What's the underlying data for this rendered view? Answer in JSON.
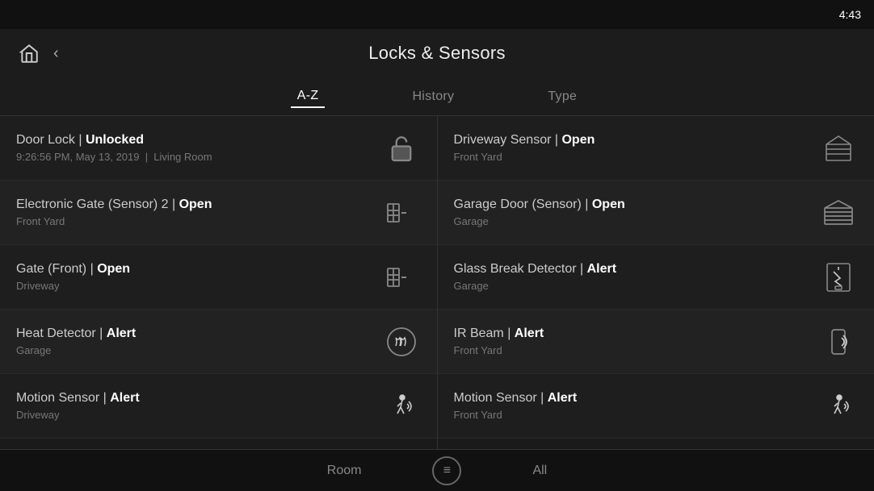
{
  "topbar": {
    "time": "4:43"
  },
  "header": {
    "title": "Locks & Sensors",
    "back_label": "‹",
    "home_icon": "🏠"
  },
  "tabs": [
    {
      "id": "az",
      "label": "A-Z",
      "active": true
    },
    {
      "id": "history",
      "label": "History",
      "active": false
    },
    {
      "id": "type",
      "label": "Type",
      "active": false
    }
  ],
  "left_col": [
    {
      "name": "Door Lock",
      "status": "Unlocked",
      "sub": "9:26:56 PM, May 13, 2019  |  Living Room",
      "icon": "lock"
    },
    {
      "name": "Electronic Gate (Sensor) 2",
      "status": "Open",
      "sub": "Front Yard",
      "icon": "gate"
    },
    {
      "name": "Gate (Front)",
      "status": "Open",
      "sub": "Driveway",
      "icon": "gate"
    },
    {
      "name": "Heat Detector",
      "status": "Alert",
      "sub": "Garage",
      "icon": "heat"
    },
    {
      "name": "Motion Sensor",
      "status": "Alert",
      "sub": "Driveway",
      "icon": "motion"
    }
  ],
  "right_col": [
    {
      "name": "Driveway Sensor",
      "status": "Open",
      "sub": "Front Yard",
      "icon": "driveway"
    },
    {
      "name": "Garage Door (Sensor)",
      "status": "Open",
      "sub": "Garage",
      "icon": "garage"
    },
    {
      "name": "Glass Break Detector",
      "status": "Alert",
      "sub": "Garage",
      "icon": "glass"
    },
    {
      "name": "IR Beam",
      "status": "Alert",
      "sub": "Front Yard",
      "icon": "irbeam"
    },
    {
      "name": "Motion Sensor",
      "status": "Alert",
      "sub": "Front Yard",
      "icon": "motion"
    }
  ],
  "bottom": {
    "room_label": "Room",
    "all_label": "All",
    "filter_icon": "≡"
  }
}
